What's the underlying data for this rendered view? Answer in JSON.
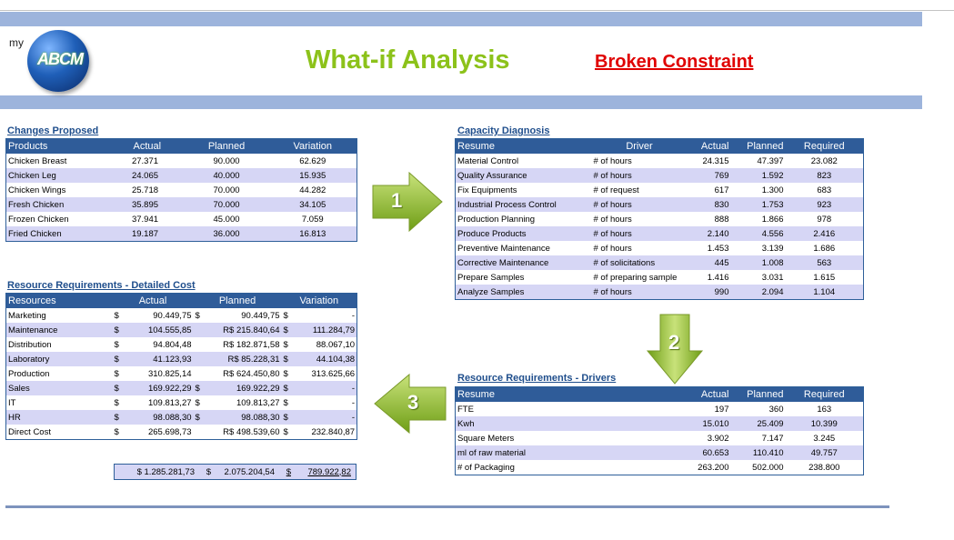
{
  "header": {
    "logo_prefix": "my",
    "logo_text": "ABCM",
    "title": "What-if Analysis",
    "status": "Broken Constraint"
  },
  "changes": {
    "section_title": "Changes Proposed",
    "columns": [
      "Products",
      "Actual",
      "Planned",
      "Variation"
    ],
    "rows": [
      [
        "Chicken Breast",
        "27.371",
        "90.000",
        "62.629"
      ],
      [
        "Chicken Leg",
        "24.065",
        "40.000",
        "15.935"
      ],
      [
        "Chicken Wings",
        "25.718",
        "70.000",
        "44.282"
      ],
      [
        "Fresh Chicken",
        "35.895",
        "70.000",
        "34.105"
      ],
      [
        "Frozen Chicken",
        "37.941",
        "45.000",
        "7.059"
      ],
      [
        "Fried Chicken",
        "19.187",
        "36.000",
        "16.813"
      ]
    ]
  },
  "capacity": {
    "section_title": "Capacity Diagnosis",
    "columns": [
      "Resume",
      "Driver",
      "Actual",
      "Planned",
      "Required"
    ],
    "rows": [
      [
        "Material Control",
        "# of hours",
        "24.315",
        "47.397",
        "23.082"
      ],
      [
        "Quality Assurance",
        "# of hours",
        "769",
        "1.592",
        "823"
      ],
      [
        "Fix Equipments",
        "# of request",
        "617",
        "1.300",
        "683"
      ],
      [
        "Industrial Process Control",
        "# of hours",
        "830",
        "1.753",
        "923"
      ],
      [
        "Production Planning",
        "# of hours",
        "888",
        "1.866",
        "978"
      ],
      [
        "Produce Products",
        "# of hours",
        "2.140",
        "4.556",
        "2.416"
      ],
      [
        "Preventive Maintenance",
        "# of hours",
        "1.453",
        "3.139",
        "1.686"
      ],
      [
        "Corrective Maintenance",
        "# of solicitations",
        "445",
        "1.008",
        "563"
      ],
      [
        "Prepare Samples",
        "# of preparing sample",
        "1.416",
        "3.031",
        "1.615"
      ],
      [
        "Analyze Samples",
        "# of hours",
        "990",
        "2.094",
        "1.104"
      ]
    ]
  },
  "resources": {
    "section_title": "Resource Requirements - Detailed Cost",
    "columns": [
      "Resources",
      "Actual",
      "Planned",
      "Variation"
    ],
    "rows": [
      [
        "Marketing",
        "$",
        "90.449,75",
        "$",
        "90.449,75",
        "$",
        "-"
      ],
      [
        "Maintenance",
        "$",
        "104.555,85",
        "",
        "R$ 215.840,64",
        "$",
        "111.284,79"
      ],
      [
        "Distribution",
        "$",
        "94.804,48",
        "",
        "R$ 182.871,58",
        "$",
        "88.067,10"
      ],
      [
        "Laboratory",
        "$",
        "41.123,93",
        "",
        "R$ 85.228,31",
        "$",
        "44.104,38"
      ],
      [
        "Production",
        "$",
        "310.825,14",
        "",
        "R$ 624.450,80",
        "$",
        "313.625,66"
      ],
      [
        "Sales",
        "$",
        "169.922,29",
        "$",
        "169.922,29",
        "$",
        "-"
      ],
      [
        "IT",
        "$",
        "109.813,27",
        "$",
        "109.813,27",
        "$",
        "-"
      ],
      [
        "HR",
        "$",
        "98.088,30",
        "$",
        "98.088,30",
        "$",
        "-"
      ],
      [
        "Direct Cost",
        "$",
        "265.698,73",
        "",
        "R$ 498.539,60",
        "$",
        "232.840,87"
      ]
    ],
    "total": {
      "actual": "$ 1.285.281,73",
      "planned_cur": "$",
      "planned": "2.075.204,54",
      "variation_cur": "$",
      "variation": "789.922,82"
    }
  },
  "drivers": {
    "section_title": "Resource Requirements - Drivers",
    "columns": [
      "Resume",
      "Actual",
      "Planned",
      "Required"
    ],
    "rows": [
      [
        "FTE",
        "197",
        "360",
        "163"
      ],
      [
        "Kwh",
        "15.010",
        "25.409",
        "10.399"
      ],
      [
        "Square Meters",
        "3.902",
        "7.147",
        "3.245"
      ],
      [
        "ml of raw material",
        "60.653",
        "110.410",
        "49.757"
      ],
      [
        "# of Packaging",
        "263.200",
        "502.000",
        "238.800"
      ]
    ]
  },
  "arrows": {
    "step1": "1",
    "step2": "2",
    "step3": "3"
  },
  "colors": {
    "band": "#9db4dc",
    "header_fill": "#2f5c99",
    "alt_row": "#d6d6f5",
    "title_green": "#8cc21a",
    "alert_red": "#e00000",
    "arrow_green": "#8fbf22"
  }
}
